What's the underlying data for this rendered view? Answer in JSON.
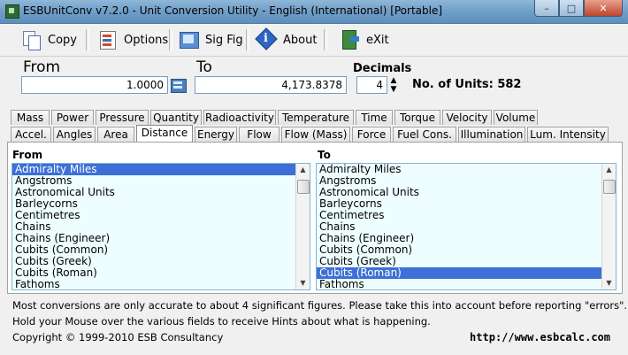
{
  "window": {
    "title": "ESBUnitConv v7.2.0 - Unit Conversion Utility - English (International) [Portable]",
    "controls": {
      "minimize": "–",
      "maximize": "□",
      "close": "✕"
    }
  },
  "toolbar": {
    "copy_label": "Copy",
    "options_label": "Options",
    "sigfig_label": "Sig Fig",
    "about_label": "About",
    "exit_label": "eXit"
  },
  "conversion": {
    "from_label": "From",
    "to_label": "To",
    "from_value": "1.0000",
    "to_value": "4,173.8378",
    "decimals_label": "Decimals",
    "decimals_value": "4",
    "units_label": "No. of Units: 582"
  },
  "tabs_row1": [
    "Mass",
    "Power",
    "Pressure",
    "Quantity",
    "Radioactivity",
    "Temperature",
    "Time",
    "Torque",
    "Velocity",
    "Volume"
  ],
  "tabs_row2": [
    "Accel.",
    "Angles",
    "Area",
    "Distance",
    "Energy",
    "Flow",
    "Flow (Mass)",
    "Force",
    "Fuel Cons.",
    "Illumination",
    "Lum. Intensity"
  ],
  "active_tab": "Distance",
  "lists": {
    "from_title": "From",
    "to_title": "To",
    "from_items": [
      "Admiralty Miles",
      "Angstroms",
      "Astronomical Units",
      "Barleycorns",
      "Centimetres",
      "Chains",
      "Chains (Engineer)",
      "Cubits (Common)",
      "Cubits (Greek)",
      "Cubits (Roman)",
      "Fathoms"
    ],
    "to_items": [
      "Admiralty Miles",
      "Angstroms",
      "Astronomical Units",
      "Barleycorns",
      "Centimetres",
      "Chains",
      "Chains (Engineer)",
      "Cubits (Common)",
      "Cubits (Greek)",
      "Cubits (Roman)",
      "Fathoms"
    ],
    "from_selected": "Admiralty Miles",
    "to_selected": "Cubits (Roman)"
  },
  "status": {
    "line1": "Most conversions are only accurate to about 4 significant figures. Please take this into account before reporting \"errors\".",
    "line2": "Hold your Mouse over the various fields to receive Hints about what is happening.",
    "copyright": "Copyright © 1999-2010 ESB Consultancy",
    "url": "http://www.esbcalc.com"
  }
}
